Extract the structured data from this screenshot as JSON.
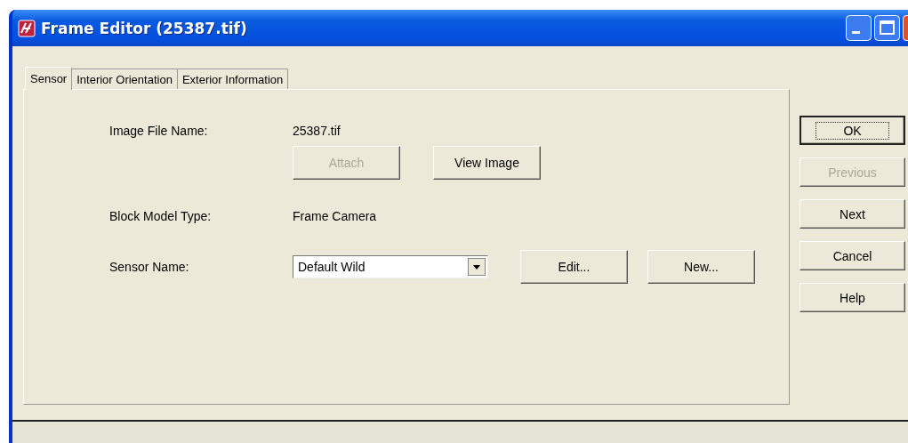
{
  "window": {
    "title": "Frame Editor (25387.tif)"
  },
  "tabs": [
    {
      "label": "Sensor",
      "selected": true
    },
    {
      "label": "Interior Orientation",
      "selected": false
    },
    {
      "label": "Exterior Information",
      "selected": false
    }
  ],
  "image_file": {
    "label": "Image File Name:",
    "value": "25387.tif",
    "buttons": [
      {
        "label": "Attach",
        "disabled": true
      },
      {
        "label": "View Image",
        "disabled": false
      }
    ]
  },
  "block_model": {
    "label": "Block Model Type:",
    "value": "Frame Camera"
  },
  "sensor": {
    "label": "Sensor Name:",
    "value": "Default Wild",
    "buttons": [
      {
        "label": "Edit...",
        "disabled": false
      },
      {
        "label": "New...",
        "disabled": false
      }
    ]
  },
  "side_buttons": [
    {
      "label": "OK",
      "default": true,
      "disabled": false
    },
    {
      "label": "Previous",
      "default": false,
      "disabled": true
    },
    {
      "label": "Next",
      "default": false,
      "disabled": false
    },
    {
      "label": "Cancel",
      "default": false,
      "disabled": false
    },
    {
      "label": "Help",
      "default": false,
      "disabled": false
    }
  ]
}
